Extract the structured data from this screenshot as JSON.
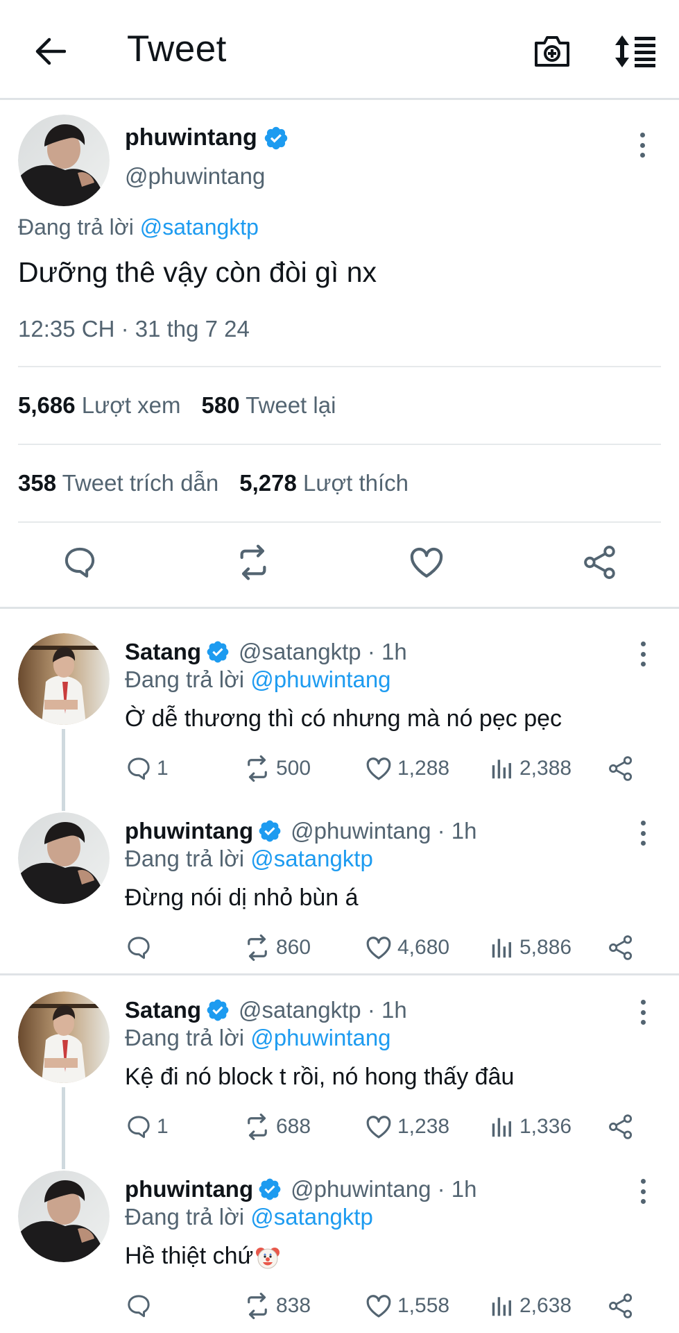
{
  "header": {
    "title": "Tweet",
    "icons": {
      "back": "arrow-left-icon",
      "camera": "camera-plus-icon",
      "sort": "sort-list-icon"
    }
  },
  "main_tweet": {
    "display_name": "phuwintang",
    "handle": "@phuwintang",
    "replying_label": "Đang trả lời",
    "replying_to": "@satangktp",
    "text": "Dưỡng thê vậy còn đòi gì nx",
    "timestamp": "12:35 CH · 31 thg 7 24",
    "views_count": "5,686",
    "views_label": "Lượt xem",
    "retweets_count": "580",
    "retweets_label": "Tweet lại",
    "quotes_count": "358",
    "quotes_label": "Tweet trích dẫn",
    "likes_count": "5,278",
    "likes_label": "Lượt thích"
  },
  "replies": [
    {
      "display_name": "Satang",
      "handle": "@satangktp",
      "time": "· 1h",
      "replying_label": "Đang trả lời",
      "replying_to": "@phuwintang",
      "text": "Ờ dễ thương thì có nhưng mà nó pẹc pẹc",
      "reply_count": "1",
      "retweet_count": "500",
      "like_count": "1,288",
      "view_count": "2,388"
    },
    {
      "display_name": "phuwintang",
      "handle": "@phuwintang",
      "time": "· 1h",
      "replying_label": "Đang trả lời",
      "replying_to": "@satangktp",
      "text": "Đừng nói dị nhỏ bùn á",
      "reply_count": "",
      "retweet_count": "860",
      "like_count": "4,680",
      "view_count": "5,886"
    },
    {
      "display_name": "Satang",
      "handle": "@satangktp",
      "time": "· 1h",
      "replying_label": "Đang trả lời",
      "replying_to": "@phuwintang",
      "text": "Kệ đi nó block t rồi, nó hong thấy đâu",
      "reply_count": "1",
      "retweet_count": "688",
      "like_count": "1,238",
      "view_count": "1,336"
    },
    {
      "display_name": "phuwintang",
      "handle": "@phuwintang",
      "time": "· 1h",
      "replying_label": "Đang trả lời",
      "replying_to": "@satangktp",
      "text": "Hề thiệt chứ",
      "reply_count": "",
      "retweet_count": "838",
      "like_count": "1,558",
      "view_count": "2,638"
    }
  ],
  "colors": {
    "link": "#1d9bf0",
    "muted": "#536471",
    "verified": "#1d9bf0",
    "divider": "#dfe3e6"
  }
}
